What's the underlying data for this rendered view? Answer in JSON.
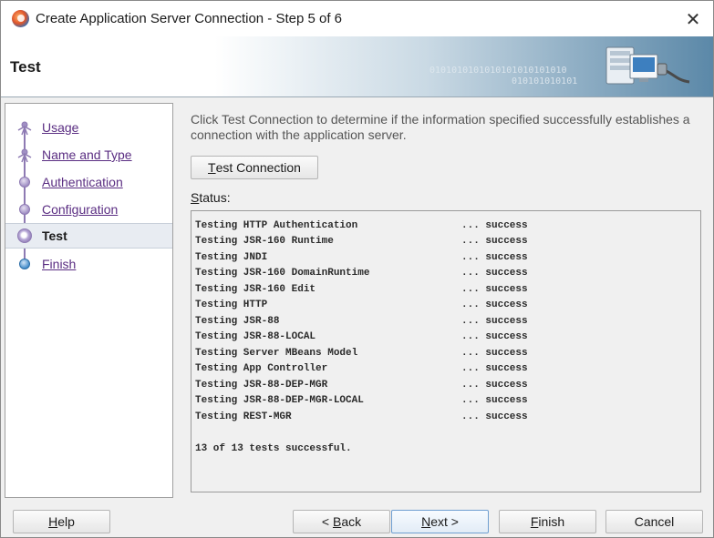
{
  "window": {
    "title": "Create Application Server Connection - Step 5 of 6",
    "close_glyph": "✕"
  },
  "header": {
    "title": "Test",
    "binary_line1": "0101010101010101010101010",
    "binary_line2": "010101010101"
  },
  "nav": {
    "items": [
      {
        "label": "Usage",
        "state": "done"
      },
      {
        "label": "Name and Type",
        "state": "done"
      },
      {
        "label": "Authentication",
        "state": "done"
      },
      {
        "label": "Configuration",
        "state": "done"
      },
      {
        "label": "Test",
        "state": "current"
      },
      {
        "label": "Finish",
        "state": "pending"
      }
    ]
  },
  "main": {
    "description": "Click Test Connection to determine if the information specified successfully establishes a connection with the application server.",
    "test_button": {
      "mnemonic": "T",
      "rest": "est Connection"
    },
    "status_label": {
      "mnemonic": "S",
      "rest": "tatus:"
    },
    "status_lines": [
      {
        "name": "Testing HTTP Authentication",
        "result": "... success"
      },
      {
        "name": "Testing JSR-160 Runtime",
        "result": "... success"
      },
      {
        "name": "Testing JNDI",
        "result": "... success"
      },
      {
        "name": "Testing JSR-160 DomainRuntime",
        "result": "... success"
      },
      {
        "name": "Testing JSR-160 Edit",
        "result": "... success"
      },
      {
        "name": "Testing HTTP",
        "result": "... success"
      },
      {
        "name": "Testing JSR-88",
        "result": "... success"
      },
      {
        "name": "Testing JSR-88-LOCAL",
        "result": "... success"
      },
      {
        "name": "Testing Server MBeans Model",
        "result": "... success"
      },
      {
        "name": "Testing App Controller",
        "result": "... success"
      },
      {
        "name": "Testing JSR-88-DEP-MGR",
        "result": "... success"
      },
      {
        "name": "Testing JSR-88-DEP-MGR-LOCAL",
        "result": "... success"
      },
      {
        "name": "Testing REST-MGR",
        "result": "... success"
      }
    ],
    "summary": "13 of 13 tests successful."
  },
  "footer": {
    "help": {
      "mnemonic": "H",
      "rest": "elp"
    },
    "back": {
      "pre": "< ",
      "mnemonic": "B",
      "rest": "ack"
    },
    "next": {
      "mnemonic": "N",
      "rest": "ext >"
    },
    "finish": {
      "mnemonic": "F",
      "rest": "inish"
    },
    "cancel": "Cancel"
  },
  "colors": {
    "link": "#5a2d82",
    "accent": "#6f9fd1"
  }
}
